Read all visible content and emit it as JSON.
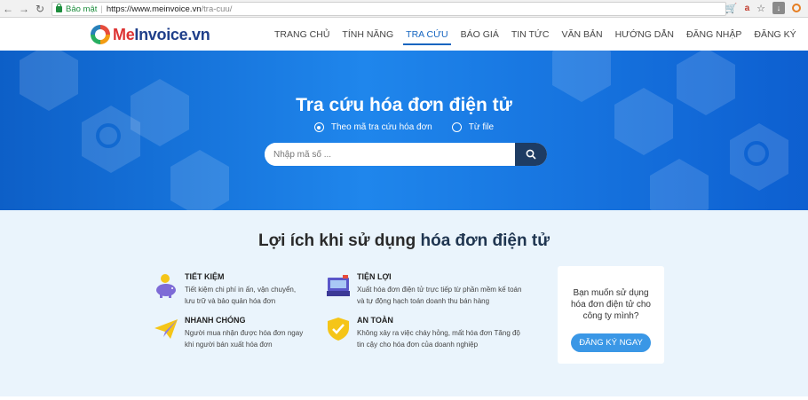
{
  "browser": {
    "secure_label": "Bảo mật",
    "url_base": "https://www.meinvoice.vn",
    "url_path": "/tra-cuu/",
    "translate_label": "a",
    "download_label": "↓"
  },
  "header": {
    "logo_me": "Me",
    "logo_rest": "Invoice.vn",
    "menu": [
      {
        "label": "TRANG CHỦ"
      },
      {
        "label": "TÍNH NĂNG"
      },
      {
        "label": "TRA CỨU"
      },
      {
        "label": "BÁO GIÁ"
      },
      {
        "label": "TIN TỨC"
      },
      {
        "label": "VĂN BẢN"
      },
      {
        "label": "HƯỚNG DẪN"
      },
      {
        "label": "ĐĂNG NHẬP"
      },
      {
        "label": "ĐĂNG KÝ"
      }
    ],
    "active_index": 2
  },
  "hero": {
    "title": "Tra cứu hóa đơn điện tử",
    "option_code": "Theo mã tra cứu hóa đơn",
    "option_file": "Từ file",
    "search_placeholder": "Nhập mã số ..."
  },
  "benefits": {
    "title_plain": "Lợi ích khi sử dụng ",
    "title_bold": "hóa đơn điện tử",
    "items": [
      {
        "title": "TIẾT KIỆM",
        "line1": "Tiết kiệm chi phí in ấn, vận chuyển,",
        "line2": "lưu trữ và bảo quản hóa đơn",
        "icon": "piggy-bank-icon"
      },
      {
        "title": "TIỆN LỢI",
        "line1": "Xuất hóa đơn điện tử trực tiếp từ phần mềm kế toán",
        "line2": "và tự động hạch toán doanh thu bán hàng",
        "icon": "cash-register-icon"
      },
      {
        "title": "NHANH CHÓNG",
        "line1": "Người mua nhận được hóa đơn ngay",
        "line2": "khi người bán xuất hóa đơn",
        "icon": "paper-plane-icon"
      },
      {
        "title": "AN TOÀN",
        "line1": "Không xảy ra việc cháy hỏng, mất hóa đơn Tăng độ",
        "line2": "tin cậy cho hóa đơn của doanh nghiệp",
        "icon": "shield-check-icon"
      }
    ],
    "cta_text": "Bạn muốn sử dụng hóa đơn điện tử cho công ty mình?",
    "cta_button": "ĐĂNG KÝ NGAY"
  },
  "colors": {
    "accent": "#1565c0",
    "hero_blue": "#1f86ec",
    "search_button": "#1e3c63",
    "cta_button": "#3a97e6"
  }
}
